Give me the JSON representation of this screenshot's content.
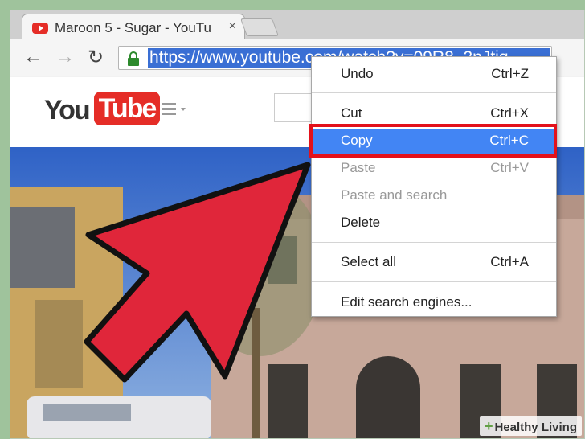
{
  "browser": {
    "tab_title": "Maroon 5 - Sugar - YouTu",
    "tab_close": "×",
    "url": "https://www.youtube.com/watch?v=09R8_2nJtjg",
    "nav": {
      "back": "←",
      "forward": "→",
      "reload": "↻"
    }
  },
  "page": {
    "logo_you": "You",
    "logo_tube": "Tube"
  },
  "context_menu": {
    "items": [
      {
        "label": "Undo",
        "shortcut": "Ctrl+Z",
        "state": "enabled"
      },
      {
        "label": "Cut",
        "shortcut": "Ctrl+X",
        "state": "enabled"
      },
      {
        "label": "Copy",
        "shortcut": "Ctrl+C",
        "state": "highlighted"
      },
      {
        "label": "Paste",
        "shortcut": "Ctrl+V",
        "state": "disabled"
      },
      {
        "label": "Paste and search",
        "shortcut": "",
        "state": "disabled"
      },
      {
        "label": "Delete",
        "shortcut": "",
        "state": "enabled"
      },
      {
        "label": "Select all",
        "shortcut": "Ctrl+A",
        "state": "enabled"
      },
      {
        "label": "Edit search engines...",
        "shortcut": "",
        "state": "enabled"
      }
    ]
  },
  "watermark": {
    "text": "Healthy Living",
    "plus": "+"
  },
  "colors": {
    "highlight": "#4285f4",
    "annotation_red": "#e3111b",
    "arrow_fill": "#e0263a",
    "youtube_red": "#e52d27",
    "url_selection": "#3a6fd4"
  }
}
